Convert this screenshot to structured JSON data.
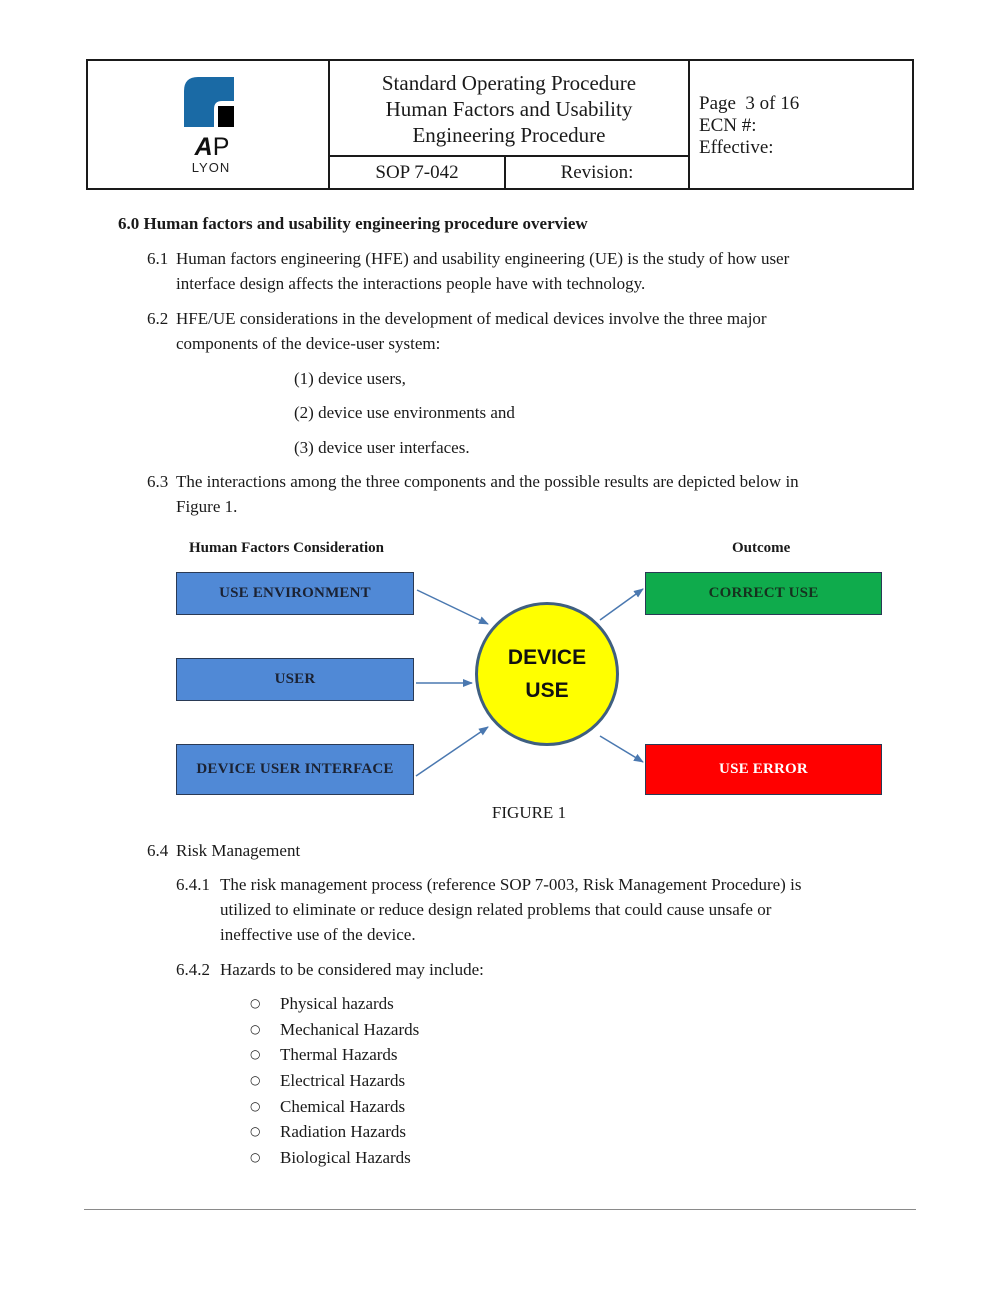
{
  "header": {
    "logo": {
      "mark_colors": {
        "blue": "#1a6aa5",
        "black": "#000000"
      },
      "brand_a": "A",
      "brand_p": "P",
      "brand_city": "LYON"
    },
    "title_lines": [
      "Standard Operating Procedure",
      "Human Factors and Usability",
      "Engineering Procedure"
    ],
    "sop_number": "SOP 7-042",
    "revision_label": "Revision:",
    "page_label": "Page  3 of 16",
    "ecn_label": "ECN #:",
    "effective_label": "Effective:"
  },
  "section": {
    "heading": "6.0 Human factors and usability engineering procedure overview",
    "p61": {
      "num": "6.1",
      "lines": [
        "Human factors engineering (HFE) and usability engineering (UE) is the study of how user",
        "interface design affects the interactions people have with technology."
      ]
    },
    "p62": {
      "num": "6.2",
      "lines": [
        "HFE/UE considerations in the development of medical devices involve the three major",
        "components of the device-user system:"
      ],
      "items": [
        "(1) device users,",
        "(2) device use environments and",
        "(3) device user interfaces."
      ]
    },
    "p63": {
      "num": "6.3",
      "lines": [
        "The interactions among the three components and the possible results are depicted below in",
        "Figure 1."
      ]
    }
  },
  "figure": {
    "left_heading": "Human Factors Consideration",
    "right_heading": "Outcome",
    "inputs": [
      "USE ENVIRONMENT",
      "USER",
      "DEVICE USER INTERFACE"
    ],
    "center": [
      "DEVICE",
      "USE"
    ],
    "outcomes": {
      "correct": "CORRECT USE",
      "error": "USE ERROR"
    },
    "caption": "FIGURE 1",
    "colors": {
      "input": "#5089d6",
      "correct": "#0fab4c",
      "error": "#ff0000",
      "center": "#ffff00",
      "arrow": "#4a78b0"
    }
  },
  "risk": {
    "num": "6.4",
    "title": "Risk Management",
    "p641": {
      "num": "6.4.1",
      "lines": [
        "The risk management process (reference SOP 7-003, Risk Management Procedure) is",
        "utilized to eliminate or reduce design related problems that could cause unsafe or",
        "ineffective use of the device."
      ]
    },
    "p642": {
      "num": "6.4.2",
      "text": "Hazards to be considered may include:",
      "bullet_symbol": "○",
      "hazards": [
        "Physical hazards",
        "Mechanical Hazards",
        "Thermal Hazards",
        "Electrical Hazards",
        "Chemical Hazards",
        "Radiation Hazards",
        "Biological Hazards"
      ]
    }
  }
}
